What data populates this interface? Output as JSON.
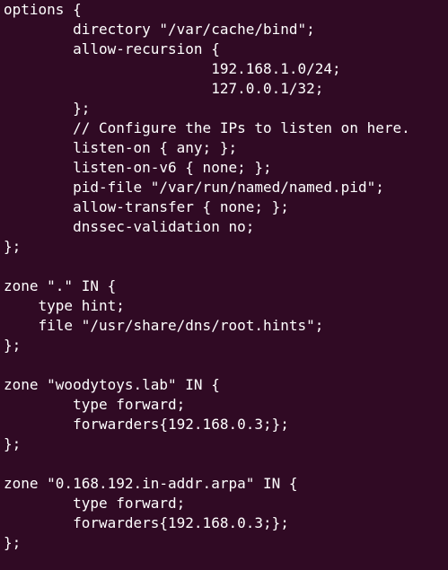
{
  "terminal": {
    "background_color": "#300a24",
    "text_color": "#ffffff",
    "lines": [
      "options {",
      "        directory \"/var/cache/bind\";",
      "        allow-recursion {",
      "                        192.168.1.0/24;",
      "                        127.0.0.1/32;",
      "        };",
      "        // Configure the IPs to listen on here.",
      "        listen-on { any; };",
      "        listen-on-v6 { none; };",
      "        pid-file \"/var/run/named/named.pid\";",
      "        allow-transfer { none; };",
      "        dnssec-validation no;",
      "};",
      "",
      "zone \".\" IN {",
      "    type hint;",
      "    file \"/usr/share/dns/root.hints\";",
      "};",
      "",
      "zone \"woodytoys.lab\" IN {",
      "        type forward;",
      "        forwarders{192.168.0.3;};",
      "};",
      "",
      "zone \"0.168.192.in-addr.arpa\" IN {",
      "        type forward;",
      "        forwarders{192.168.0.3;};",
      "};"
    ]
  }
}
